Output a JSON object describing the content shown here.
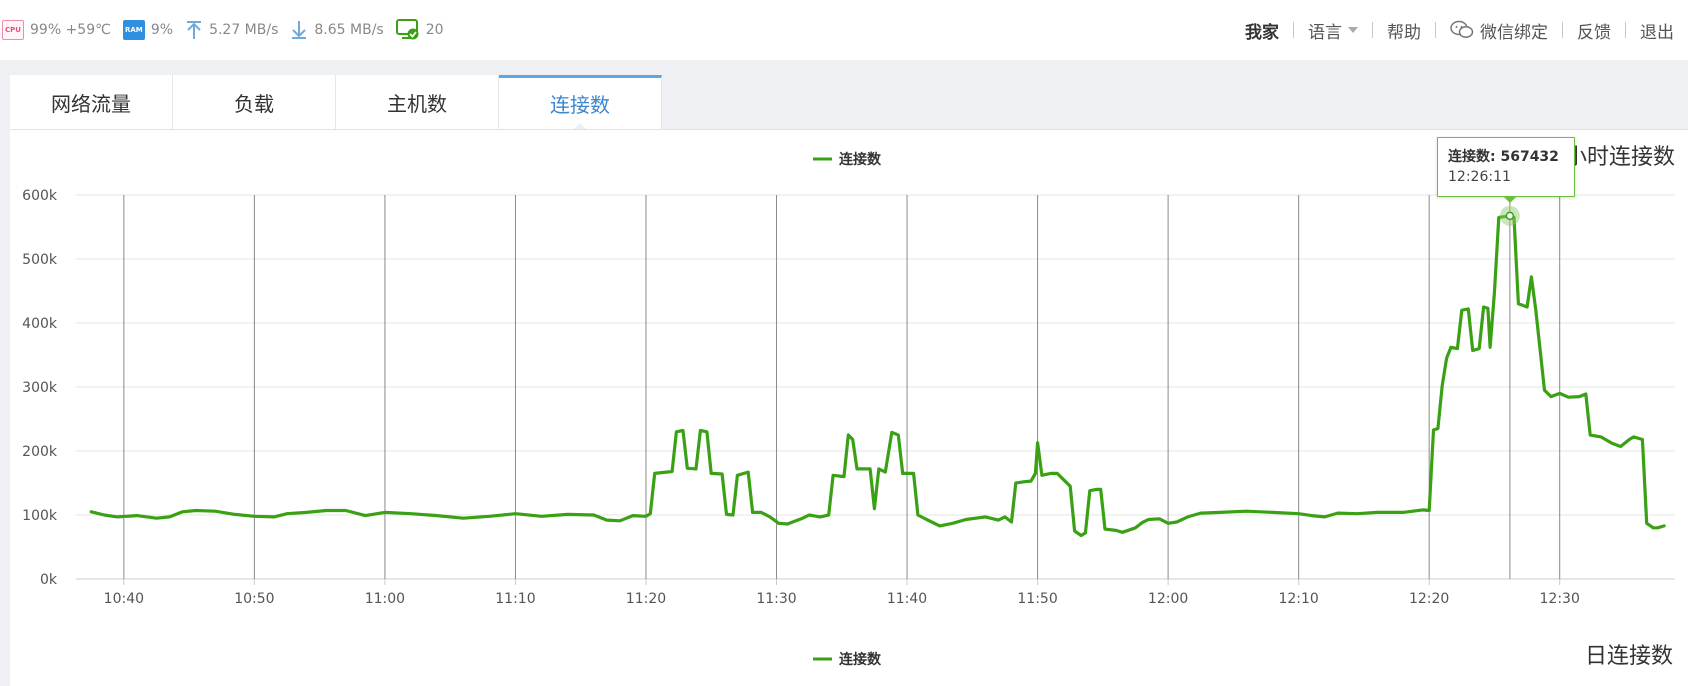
{
  "status_bar": {
    "cpu_label": "CPU",
    "cpu_text": "99% +59℃",
    "ram_label": "RAM",
    "ram_text": "9%",
    "upload_text": "5.27 MB/s",
    "download_text": "8.65 MB/s",
    "hosts_text": "20",
    "icons": [
      "cpu-chip-icon",
      "ram-chip-icon",
      "upload-arrow-icon",
      "download-arrow-icon",
      "monitor-check-icon"
    ]
  },
  "nav": {
    "home": "我家",
    "language": "语言",
    "help": "帮助",
    "wechat": "微信绑定",
    "feedback": "反馈",
    "logout": "退出"
  },
  "tabs": [
    {
      "label": "网络流量",
      "active": false
    },
    {
      "label": "负载",
      "active": false
    },
    {
      "label": "主机数",
      "active": false
    },
    {
      "label": "连接数",
      "active": true
    }
  ],
  "chart_titles": {
    "hourly": "小时连接数",
    "daily": "日连接数",
    "second_legend": "连接数"
  },
  "tooltip": {
    "label": "连接数: 567432",
    "time": "12:26:11"
  },
  "colors": {
    "line": "#3aa115",
    "accent": "#3a86cf"
  },
  "chart_data": {
    "type": "line",
    "legend": "连接数",
    "legend_position": "top-center",
    "grid": true,
    "x_ticks": [
      "10:40",
      "10:50",
      "11:00",
      "11:10",
      "11:20",
      "11:30",
      "11:40",
      "11:50",
      "12:00",
      "12:10",
      "12:20",
      "12:30"
    ],
    "y_ticks": [
      "0k",
      "100k",
      "200k",
      "300k",
      "400k",
      "500k",
      "600k"
    ],
    "ylim": [
      0,
      600000
    ],
    "xlim": [
      "10:36:20",
      "12:38:50"
    ],
    "series": [
      {
        "name": "连接数",
        "points": [
          [
            "10:37:30",
            105000
          ],
          [
            "10:38:30",
            100000
          ],
          [
            "10:39:30",
            97000
          ],
          [
            "10:41:00",
            99000
          ],
          [
            "10:42:30",
            95000
          ],
          [
            "10:43:30",
            97000
          ],
          [
            "10:44:30",
            105000
          ],
          [
            "10:45:30",
            107000
          ],
          [
            "10:47:00",
            106000
          ],
          [
            "10:48:30",
            101000
          ],
          [
            "10:50:00",
            98000
          ],
          [
            "10:51:30",
            97000
          ],
          [
            "10:52:30",
            102000
          ],
          [
            "10:54:00",
            104000
          ],
          [
            "10:55:30",
            107000
          ],
          [
            "10:57:00",
            107000
          ],
          [
            "10:58:30",
            99000
          ],
          [
            "11:00:00",
            104000
          ],
          [
            "11:02:00",
            102000
          ],
          [
            "11:04:00",
            99000
          ],
          [
            "11:06:00",
            95000
          ],
          [
            "11:08:00",
            98000
          ],
          [
            "11:10:00",
            102000
          ],
          [
            "11:12:00",
            98000
          ],
          [
            "11:14:00",
            101000
          ],
          [
            "11:16:00",
            100000
          ],
          [
            "11:17:00",
            92000
          ],
          [
            "11:18:00",
            91000
          ],
          [
            "11:19:00",
            99000
          ],
          [
            "11:20:00",
            98000
          ],
          [
            "11:20:20",
            102000
          ],
          [
            "11:20:40",
            165000
          ],
          [
            "11:22:00",
            168000
          ],
          [
            "11:22:20",
            230000
          ],
          [
            "11:22:50",
            232000
          ],
          [
            "11:23:10",
            173000
          ],
          [
            "11:23:50",
            172000
          ],
          [
            "11:24:10",
            232000
          ],
          [
            "11:24:40",
            230000
          ],
          [
            "11:25:00",
            165000
          ],
          [
            "11:25:50",
            164000
          ],
          [
            "11:26:10",
            101000
          ],
          [
            "11:26:40",
            100000
          ],
          [
            "11:27:00",
            162000
          ],
          [
            "11:27:50",
            167000
          ],
          [
            "11:28:10",
            104000
          ],
          [
            "11:28:50",
            104000
          ],
          [
            "11:29:30",
            97000
          ],
          [
            "11:30:10",
            87000
          ],
          [
            "11:30:50",
            86000
          ],
          [
            "11:32:00",
            95000
          ],
          [
            "11:32:30",
            100000
          ],
          [
            "11:33:20",
            97000
          ],
          [
            "11:34:00",
            100000
          ],
          [
            "11:34:20",
            162000
          ],
          [
            "11:35:10",
            160000
          ],
          [
            "11:35:30",
            225000
          ],
          [
            "11:35:50",
            218000
          ],
          [
            "11:36:10",
            172000
          ],
          [
            "11:37:10",
            172000
          ],
          [
            "11:37:30",
            110000
          ],
          [
            "11:37:50",
            172000
          ],
          [
            "11:38:20",
            167000
          ],
          [
            "11:38:50",
            229000
          ],
          [
            "11:39:20",
            225000
          ],
          [
            "11:39:40",
            165000
          ],
          [
            "11:40:30",
            165000
          ],
          [
            "11:40:50",
            100000
          ],
          [
            "11:41:30",
            93000
          ],
          [
            "11:42:30",
            83000
          ],
          [
            "11:43:30",
            87000
          ],
          [
            "11:44:30",
            93000
          ],
          [
            "11:46:00",
            97000
          ],
          [
            "11:47:00",
            92000
          ],
          [
            "11:47:30",
            97000
          ],
          [
            "11:48:00",
            89000
          ],
          [
            "11:48:20",
            150000
          ],
          [
            "11:49:00",
            152000
          ],
          [
            "11:49:30",
            153000
          ],
          [
            "11:49:50",
            165000
          ],
          [
            "11:50:00",
            213000
          ],
          [
            "11:50:20",
            162000
          ],
          [
            "11:51:00",
            165000
          ],
          [
            "11:51:30",
            165000
          ],
          [
            "11:52:00",
            155000
          ],
          [
            "11:52:30",
            145000
          ],
          [
            "11:52:50",
            75000
          ],
          [
            "11:53:20",
            68000
          ],
          [
            "11:53:40",
            72000
          ],
          [
            "11:54:00",
            138000
          ],
          [
            "11:54:30",
            140000
          ],
          [
            "11:54:50",
            140000
          ],
          [
            "11:55:10",
            78000
          ],
          [
            "11:56:00",
            76000
          ],
          [
            "11:56:30",
            73000
          ],
          [
            "11:57:30",
            80000
          ],
          [
            "11:58:00",
            88000
          ],
          [
            "11:58:30",
            93000
          ],
          [
            "11:59:20",
            94000
          ],
          [
            "12:00:00",
            87000
          ],
          [
            "12:00:40",
            89000
          ],
          [
            "12:01:30",
            97000
          ],
          [
            "12:02:30",
            103000
          ],
          [
            "12:04:00",
            104000
          ],
          [
            "12:06:00",
            106000
          ],
          [
            "12:08:00",
            104000
          ],
          [
            "12:10:00",
            102000
          ],
          [
            "12:11:00",
            99000
          ],
          [
            "12:12:00",
            97000
          ],
          [
            "12:13:00",
            103000
          ],
          [
            "12:14:30",
            102000
          ],
          [
            "12:16:00",
            104000
          ],
          [
            "12:18:00",
            104000
          ],
          [
            "12:19:30",
            108000
          ],
          [
            "12:20:00",
            107000
          ],
          [
            "12:20:20",
            233000
          ],
          [
            "12:20:40",
            235000
          ],
          [
            "12:21:00",
            302000
          ],
          [
            "12:21:20",
            345000
          ],
          [
            "12:21:40",
            362000
          ],
          [
            "12:22:10",
            360000
          ],
          [
            "12:22:30",
            420000
          ],
          [
            "12:23:00",
            422000
          ],
          [
            "12:23:20",
            357000
          ],
          [
            "12:23:50",
            360000
          ],
          [
            "12:24:10",
            425000
          ],
          [
            "12:24:30",
            423000
          ],
          [
            "12:24:40",
            362000
          ],
          [
            "12:25:00",
            447000
          ],
          [
            "12:25:20",
            565000
          ],
          [
            "12:26:11",
            567432
          ],
          [
            "12:26:30",
            565000
          ],
          [
            "12:26:50",
            430000
          ],
          [
            "12:27:30",
            425000
          ],
          [
            "12:27:50",
            472000
          ],
          [
            "12:28:10",
            420000
          ],
          [
            "12:28:50",
            295000
          ],
          [
            "12:29:20",
            285000
          ],
          [
            "12:30:00",
            290000
          ],
          [
            "12:30:40",
            284000
          ],
          [
            "12:31:30",
            285000
          ],
          [
            "12:32:00",
            289000
          ],
          [
            "12:32:20",
            225000
          ],
          [
            "12:33:10",
            222000
          ],
          [
            "12:34:00",
            212000
          ],
          [
            "12:34:40",
            207000
          ],
          [
            "12:35:20",
            218000
          ],
          [
            "12:35:40",
            222000
          ],
          [
            "12:36:20",
            218000
          ],
          [
            "12:36:40",
            87000
          ],
          [
            "12:37:10",
            80000
          ],
          [
            "12:37:30",
            80000
          ],
          [
            "12:38:00",
            83000
          ]
        ]
      }
    ],
    "highlight": {
      "time": "12:26:11",
      "value": 567432
    }
  },
  "chart_data_2": {
    "type": "line",
    "title": "日连接数",
    "legend": "连接数",
    "legend_position": "top-center"
  }
}
